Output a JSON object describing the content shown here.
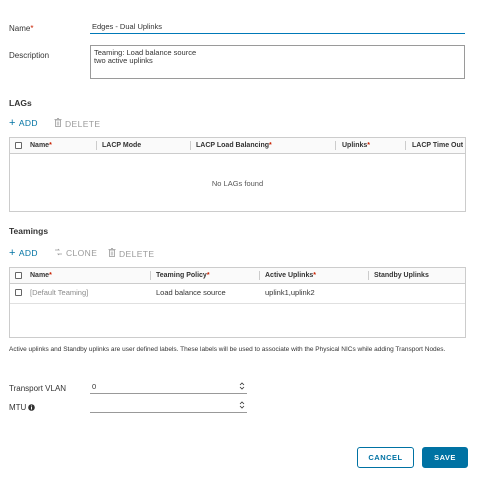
{
  "form": {
    "name_label": "Name",
    "required_mark": "*",
    "name_value": "Edges - Dual Uplinks",
    "description_label": "Description",
    "description_value": "Teaming: Load balance source\ntwo active uplinks"
  },
  "lags": {
    "title": "LAGs",
    "add_label": "ADD",
    "delete_label": "DELETE",
    "columns": [
      "Name",
      "LACP Mode",
      "LACP Load Balancing",
      "Uplinks",
      "LACP Time Out"
    ],
    "empty_text": "No LAGs found"
  },
  "teamings": {
    "title": "Teamings",
    "add_label": "ADD",
    "clone_label": "CLONE",
    "delete_label": "DELETE",
    "columns": [
      "Name",
      "Teaming Policy",
      "Active Uplinks",
      "Standby Uplinks"
    ],
    "rows": [
      {
        "name": "[Default Teaming]",
        "policy": "Load balance source",
        "active": "uplink1,uplink2",
        "standby": ""
      }
    ]
  },
  "note": "Active uplinks and Standby uplinks are user defined labels. These labels will be used to associate with the Physical NICs while adding Transport Nodes.",
  "transport_vlan": {
    "label": "Transport VLAN",
    "value": "0"
  },
  "mtu": {
    "label": "MTU",
    "value": ""
  },
  "buttons": {
    "cancel": "CANCEL",
    "save": "SAVE"
  },
  "colors": {
    "accent": "#0072a3",
    "required": "#c92100",
    "focus": "#0079b8"
  }
}
